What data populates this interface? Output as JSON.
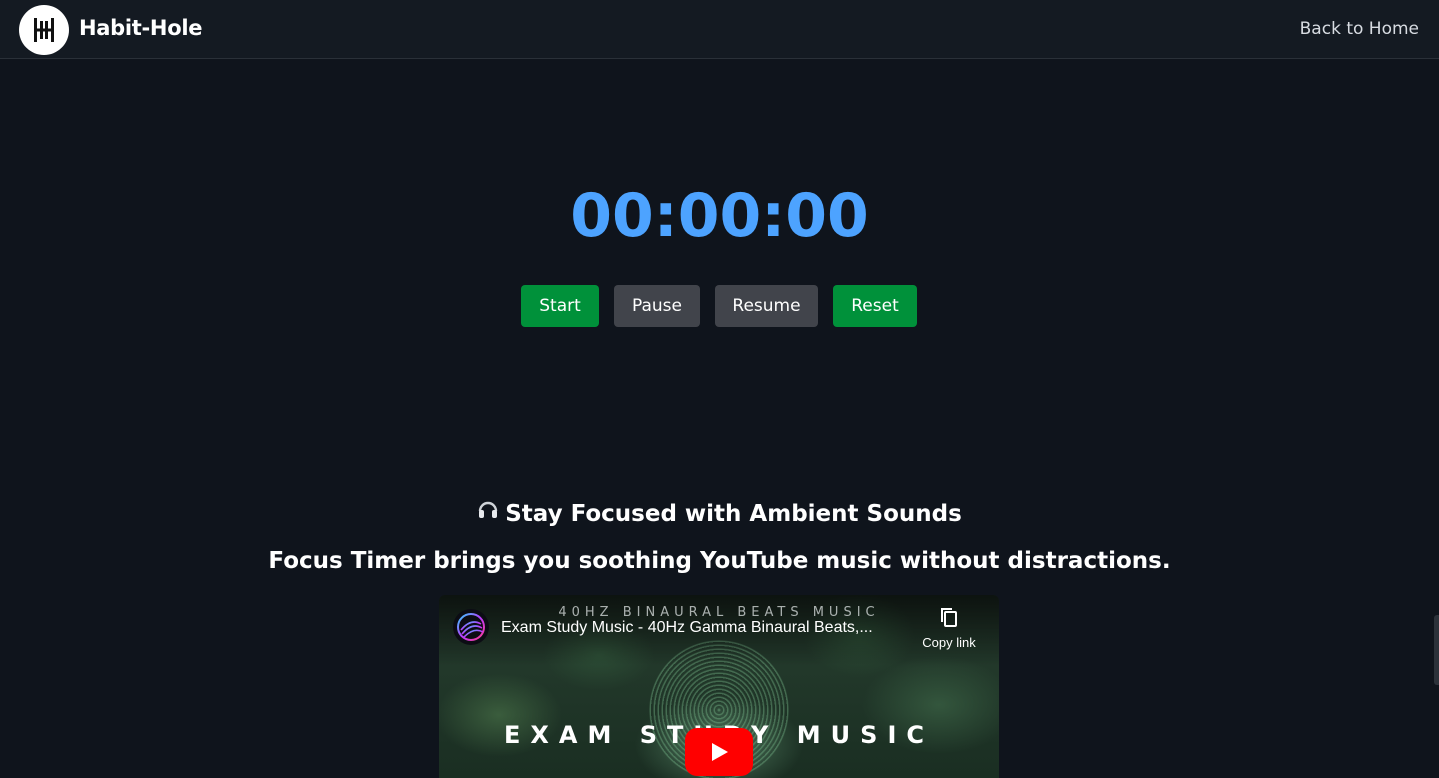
{
  "navbar": {
    "brand": "Habit-Hole",
    "back_link": "Back to Home",
    "logo_icon": "habit-hole-logo"
  },
  "timer": {
    "display": "00:00:00",
    "color": "#4da3ff"
  },
  "controls": {
    "start": "Start",
    "pause": "Pause",
    "resume": "Resume",
    "reset": "Reset",
    "green": "#00913a",
    "gray": "#41444b"
  },
  "ambient": {
    "icon": "headphones-icon",
    "heading": "Stay Focused with Ambient Sounds",
    "tagline": "Focus Timer brings you soothing YouTube music without distractions."
  },
  "video": {
    "channel_banner": "40HZ BINAURAL BEATS MUSIC",
    "title": "Exam Study Music - 40Hz Gamma Binaural Beats,...",
    "copy_link": "Copy link",
    "overlay_text": "EXAM STUDY MUSIC",
    "play_icon": "youtube-play-icon"
  }
}
